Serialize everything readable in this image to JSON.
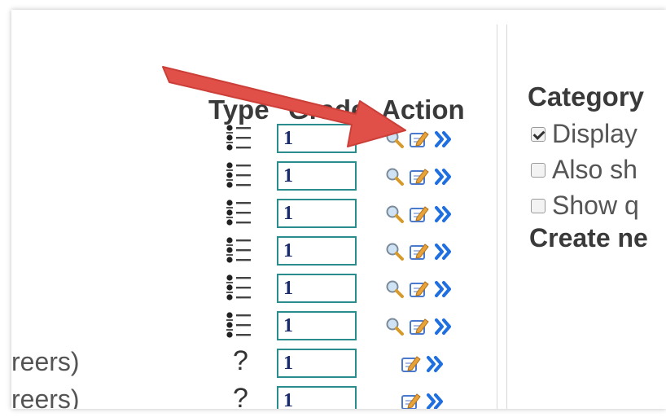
{
  "table": {
    "headers": {
      "type": "Type",
      "grade": "Grade",
      "action": "Action"
    },
    "rows": [
      {
        "name": "",
        "type_icon": "list-icon",
        "grade": "1",
        "actions": [
          "preview-icon",
          "edit-icon",
          "move-icon"
        ]
      },
      {
        "name": "",
        "type_icon": "list-icon",
        "grade": "1",
        "actions": [
          "preview-icon",
          "edit-icon",
          "move-icon"
        ]
      },
      {
        "name": "",
        "type_icon": "list-icon",
        "grade": "1",
        "actions": [
          "preview-icon",
          "edit-icon",
          "move-icon"
        ]
      },
      {
        "name": "",
        "type_icon": "list-icon",
        "grade": "1",
        "actions": [
          "preview-icon",
          "edit-icon",
          "move-icon"
        ]
      },
      {
        "name": "",
        "type_icon": "list-icon",
        "grade": "1",
        "actions": [
          "preview-icon",
          "edit-icon",
          "move-icon"
        ]
      },
      {
        "name": "",
        "type_icon": "list-icon",
        "grade": "1",
        "actions": [
          "preview-icon",
          "edit-icon",
          "move-icon"
        ]
      },
      {
        "name": "reers)",
        "type_symbol": "?",
        "grade": "1",
        "actions": [
          "edit-icon",
          "move-icon"
        ]
      },
      {
        "name": "reers)",
        "type_symbol": "?",
        "grade": "1",
        "actions": [
          "edit-icon",
          "move-icon"
        ]
      }
    ]
  },
  "category": {
    "title": "Category",
    "options": [
      {
        "label": "Display",
        "checked": true
      },
      {
        "label": "Also sh",
        "checked": false
      },
      {
        "label": "Show q",
        "checked": false
      }
    ],
    "create_label": "Create ne"
  },
  "colors": {
    "grade_border": "#2a8c8c",
    "annotation_arrow": "#e05048",
    "move_icon": "#1f6fe0",
    "preview_icon": "#d69a2a"
  }
}
